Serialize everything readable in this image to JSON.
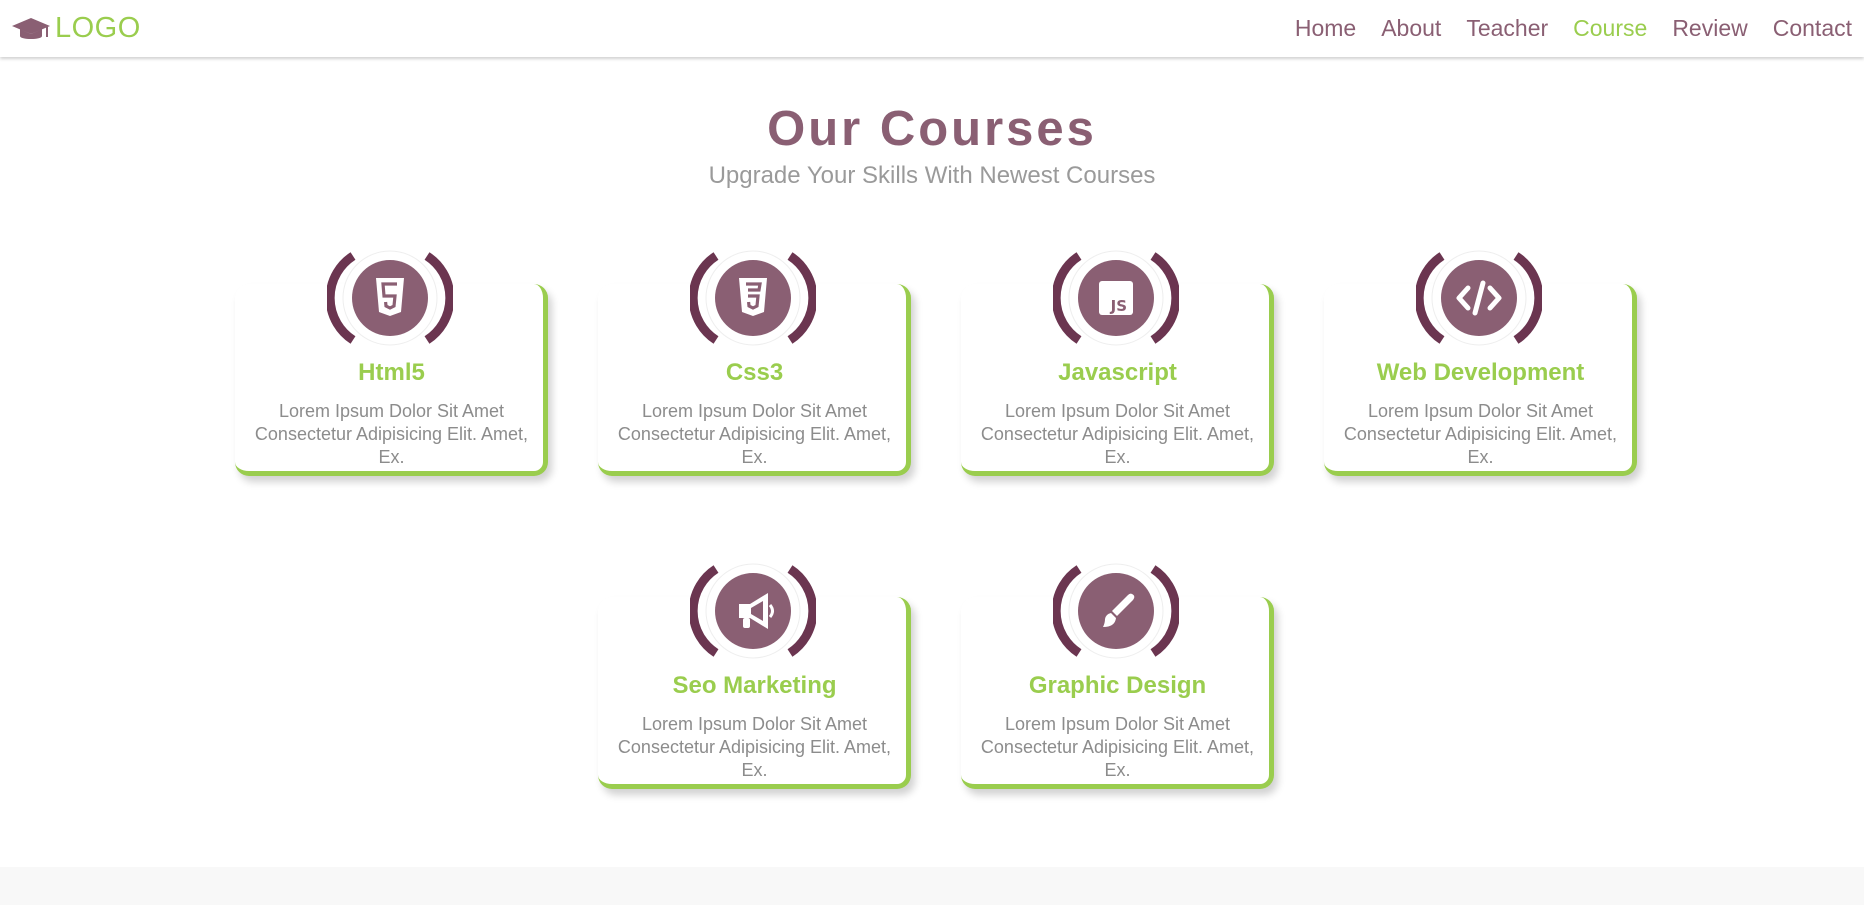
{
  "header": {
    "logo_text": "LOGO",
    "logo_icon": "graduation-cap-icon",
    "nav": [
      {
        "label": "Home",
        "active": false
      },
      {
        "label": "About",
        "active": false
      },
      {
        "label": "Teacher",
        "active": false
      },
      {
        "label": "Course",
        "active": true
      },
      {
        "label": "Review",
        "active": false
      },
      {
        "label": "Contact",
        "active": false
      }
    ]
  },
  "section": {
    "title": "Our Courses",
    "subtitle": "Upgrade Your Skills With Newest Courses"
  },
  "courses": [
    {
      "title": "Html5",
      "icon": "html5-icon",
      "description": "Lorem Ipsum Dolor Sit Amet Consectetur Adipisicing Elit. Amet, Ex."
    },
    {
      "title": "Css3",
      "icon": "css3-icon",
      "description": "Lorem Ipsum Dolor Sit Amet Consectetur Adipisicing Elit. Amet, Ex."
    },
    {
      "title": "Javascript",
      "icon": "javascript-icon",
      "description": "Lorem Ipsum Dolor Sit Amet Consectetur Adipisicing Elit. Amet, Ex."
    },
    {
      "title": "Web Development",
      "icon": "code-icon",
      "description": "Lorem Ipsum Dolor Sit Amet Consectetur Adipisicing Elit. Amet, Ex."
    },
    {
      "title": "Seo Marketing",
      "icon": "megaphone-icon",
      "description": "Lorem Ipsum Dolor Sit Amet Consectetur Adipisicing Elit. Amet, Ex."
    },
    {
      "title": "Graphic Design",
      "icon": "paint-brush-icon",
      "description": "Lorem Ipsum Dolor Sit Amet Consectetur Adipisicing Elit. Amet, Ex."
    }
  ],
  "colors": {
    "accent": "#9acd4e",
    "primary": "#8a5f73",
    "dark": "#6b3550",
    "text_muted": "#8c8c8c"
  }
}
